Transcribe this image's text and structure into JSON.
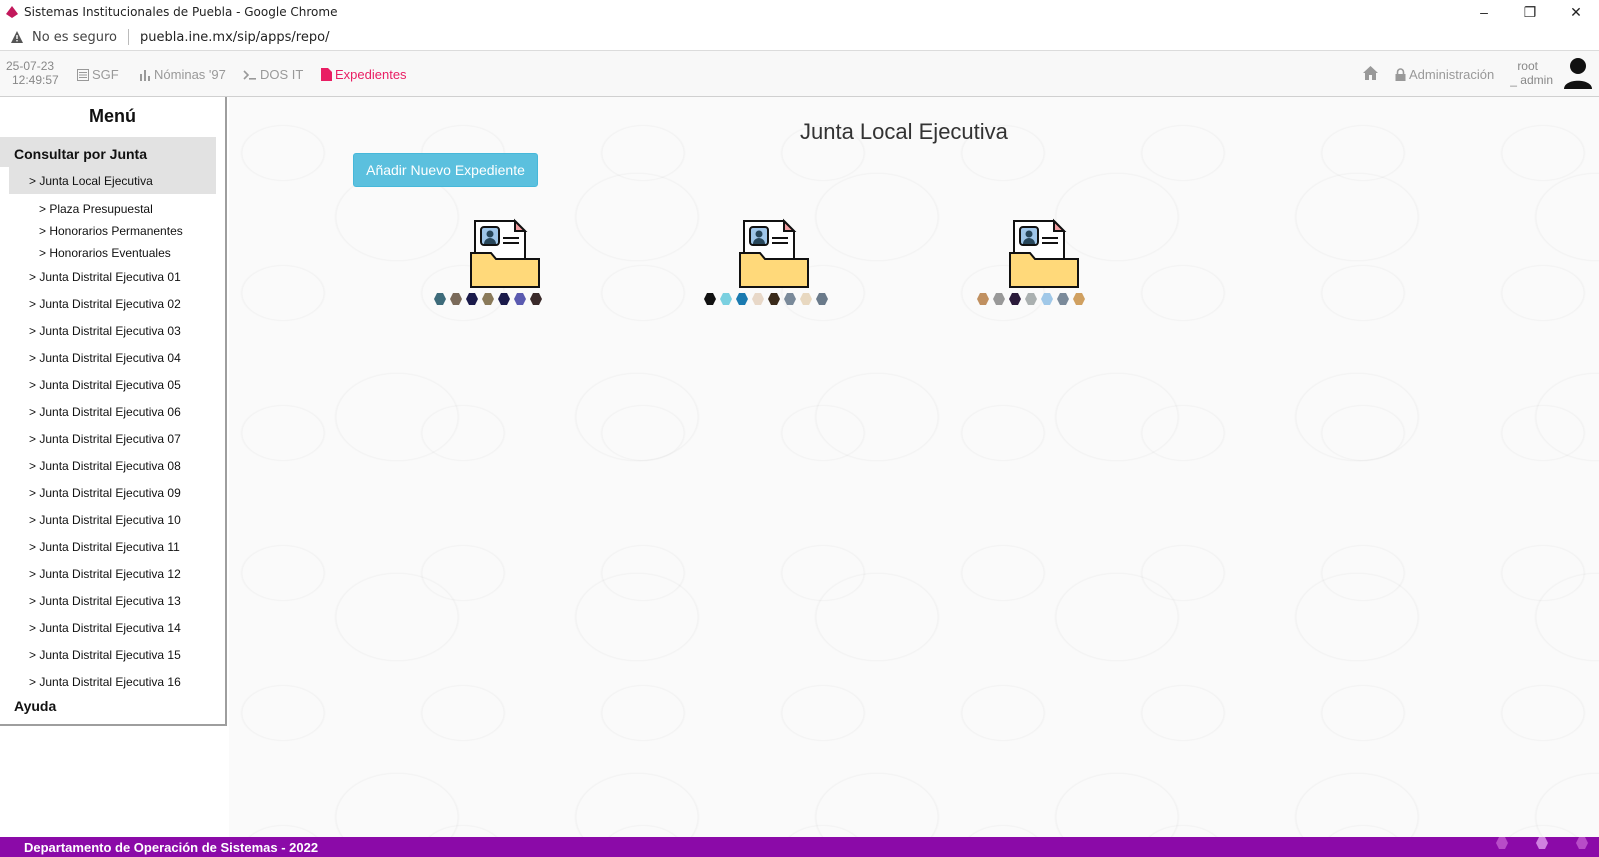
{
  "browser": {
    "window_title": "Sistemas Institucionales de Puebla - Google Chrome",
    "security": "No es seguro",
    "url": "puebla.ine.mx/sip/apps/repo/",
    "controls": [
      "minimize",
      "restore",
      "close"
    ]
  },
  "navbar": {
    "date": "25-07-23",
    "time": "12:49:57",
    "items": [
      {
        "label": "SGF",
        "icon": "list-icon"
      },
      {
        "label": "Nóminas '97",
        "icon": "bar-chart-icon"
      },
      {
        "label": "DOS IT",
        "icon": "terminal-icon"
      },
      {
        "label": "Expedientes",
        "icon": "file-icon",
        "active": true
      }
    ],
    "admin_label": "Administración",
    "user_line1": "root",
    "user_line2": "_ admin",
    "accent": "#e91e63"
  },
  "sidebar": {
    "title": "Menú",
    "section": "Consultar por Junta",
    "active_item": "> Junta Local Ejecutiva",
    "sub_items": [
      "> Plaza Presupuestal",
      "> Honorarios Permanentes",
      "> Honorarios Eventuales"
    ],
    "district_items": [
      "> Junta Distrital Ejecutiva 01",
      "> Junta Distrital Ejecutiva 02",
      "> Junta Distrital Ejecutiva 03",
      "> Junta Distrital Ejecutiva 04",
      "> Junta Distrital Ejecutiva 05",
      "> Junta Distrital Ejecutiva 06",
      "> Junta Distrital Ejecutiva 07",
      "> Junta Distrital Ejecutiva 08",
      "> Junta Distrital Ejecutiva 09",
      "> Junta Distrital Ejecutiva 10",
      "> Junta Distrital Ejecutiva 11",
      "> Junta Distrital Ejecutiva 12",
      "> Junta Distrital Ejecutiva 13",
      "> Junta Distrital Ejecutiva 14",
      "> Junta Distrital Ejecutiva 15",
      "> Junta Distrital Ejecutiva 16"
    ],
    "help": "Ayuda"
  },
  "main": {
    "title": "Junta Local Ejecutiva",
    "add_button": "Añadir Nuevo Expediente",
    "folders": [
      {
        "icon": "folder-document-icon",
        "label_colors": [
          "#3d6b7a",
          "#7a6a5a",
          "#1a1a4a",
          "#8a7a5a",
          "#1a1a4a",
          "#5a5ab0",
          "#3a2a2a"
        ]
      },
      {
        "icon": "folder-document-icon",
        "label_colors": [
          "#111",
          "#7ad0e0",
          "#1a7ab0",
          "#e8d8c8",
          "#3a2a1a",
          "#7a8a9a",
          "#e8d8c0",
          "#6a7a8a"
        ]
      },
      {
        "icon": "folder-document-icon",
        "label_colors": [
          "#c09060",
          "#999",
          "#2a1a3a",
          "#aab0b0",
          "#a0c8e8",
          "#7a8a9a",
          "#d0a060"
        ]
      }
    ]
  },
  "footer": {
    "text": "Departamento de Operación de Sistemas - 2022",
    "color": "#8b0aa8"
  }
}
